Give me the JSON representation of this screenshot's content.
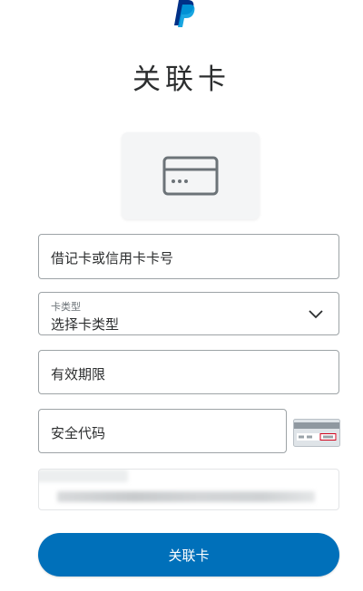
{
  "brand": {
    "logo_icon": "paypal-logo-icon",
    "color_dark": "#003087",
    "color_light": "#009cde"
  },
  "page": {
    "title": "关联卡"
  },
  "card_illustration": {
    "icon": "credit-card-icon"
  },
  "form": {
    "card_number": {
      "placeholder": "借记卡或信用卡卡号"
    },
    "card_type": {
      "label": "卡类型",
      "value": "选择卡类型",
      "icon": "chevron-down-icon"
    },
    "expiry": {
      "placeholder": "有效期限"
    },
    "security_code": {
      "placeholder": "安全代码",
      "hint_icon": "card-back-cvv-icon"
    },
    "redacted_field": {
      "state": "blurred"
    }
  },
  "submit": {
    "label": "关联卡",
    "color": "#0070ba"
  }
}
